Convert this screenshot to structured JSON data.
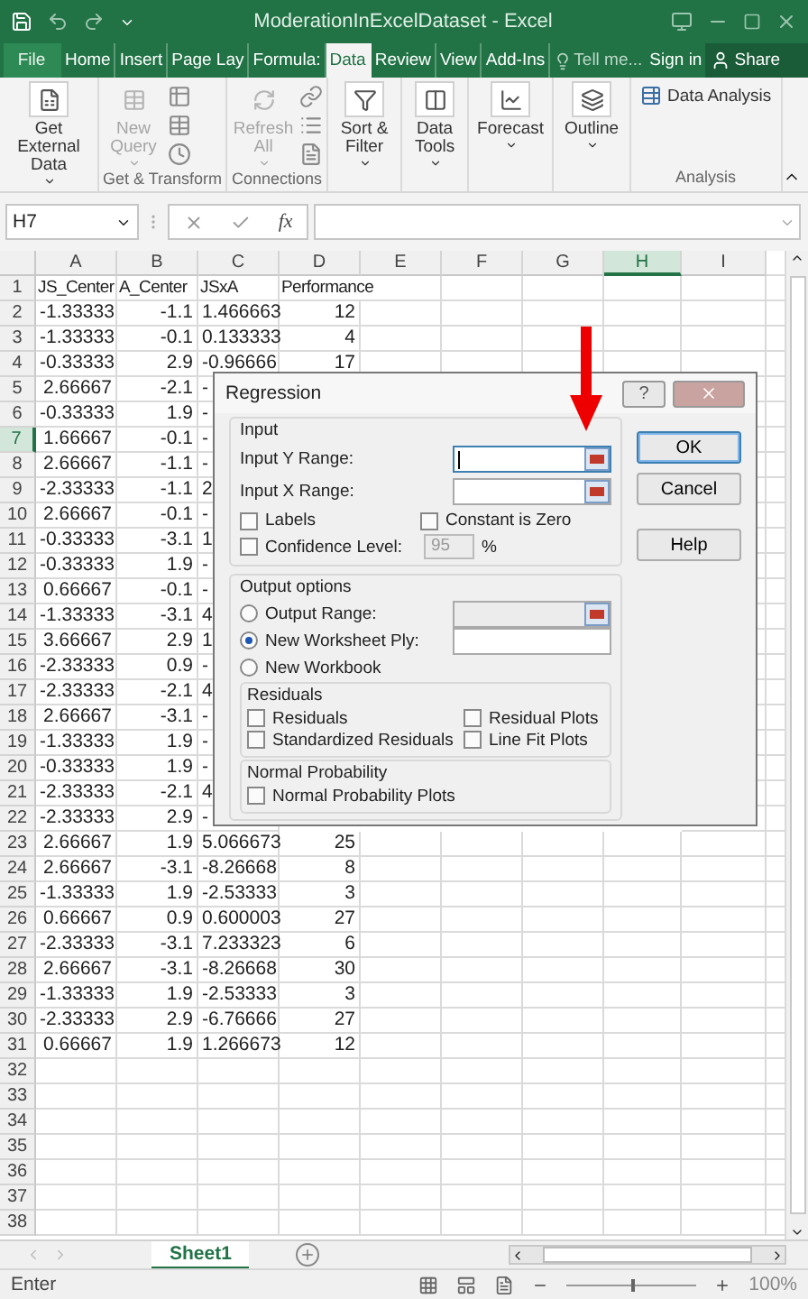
{
  "window": {
    "title": "ModerationInExcelDataset - Excel"
  },
  "ribbon_tabs": [
    {
      "label": "File",
      "selected": false
    },
    {
      "label": "Home",
      "selected": false
    },
    {
      "label": "Insert",
      "selected": false
    },
    {
      "label": "Page Lay",
      "selected": false
    },
    {
      "label": "Formula:",
      "selected": false
    },
    {
      "label": "Data",
      "selected": true
    },
    {
      "label": "Review",
      "selected": false
    },
    {
      "label": "View",
      "selected": false
    },
    {
      "label": "Add-Ins",
      "selected": false
    }
  ],
  "tell_me": "Tell me...",
  "sign_in": "Sign in",
  "share": "Share",
  "ribbon_groups": [
    {
      "buttons": [
        {
          "kind": "large",
          "label": "Get External Data",
          "disabled": false,
          "dropdown": true
        }
      ]
    },
    {
      "label": "Get & Transform",
      "buttons": [
        {
          "kind": "large",
          "label": "New Query",
          "disabled": true,
          "dropdown": true
        },
        {
          "kind": "small_stack",
          "disabled": false
        }
      ]
    },
    {
      "label": "Connections",
      "buttons": [
        {
          "kind": "large",
          "label": "Refresh All",
          "disabled": true,
          "dropdown": true
        },
        {
          "kind": "small_stack",
          "disabled": false
        }
      ]
    },
    {
      "buttons": [
        {
          "kind": "large",
          "label": "Sort & Filter",
          "disabled": false,
          "dropdown": true
        }
      ]
    },
    {
      "buttons": [
        {
          "kind": "large",
          "label": "Data Tools",
          "disabled": false,
          "dropdown": true
        }
      ]
    },
    {
      "buttons": [
        {
          "kind": "large",
          "label": "Forecast",
          "disabled": false,
          "dropdown": true
        }
      ]
    },
    {
      "buttons": [
        {
          "kind": "large",
          "label": "Outline",
          "disabled": false,
          "dropdown": true
        }
      ]
    },
    {
      "label": "Analysis",
      "buttons": [
        {
          "kind": "small",
          "label": "Data Analysis",
          "disabled": false
        }
      ]
    }
  ],
  "formula_bar": {
    "name_box": "H7",
    "function_symbol": "fx"
  },
  "columns": [
    {
      "label": "A",
      "selected": false
    },
    {
      "label": "B",
      "selected": false
    },
    {
      "label": "C",
      "selected": false
    },
    {
      "label": "D",
      "selected": false
    },
    {
      "label": "E",
      "selected": false
    },
    {
      "label": "F",
      "selected": false
    },
    {
      "label": "G",
      "selected": false
    },
    {
      "label": "H",
      "selected": true
    },
    {
      "label": "I",
      "selected": false
    }
  ],
  "rows": [
    {
      "number": "1",
      "selected": false,
      "kind": "header",
      "cells": [
        "JS_Center",
        "A_Center",
        "JSxA",
        "Performance"
      ]
    },
    {
      "number": "2",
      "selected": false,
      "cells": [
        "-1.33333",
        "-1.1",
        "1.466663",
        "12"
      ]
    },
    {
      "number": "3",
      "selected": false,
      "cells": [
        "-1.33333",
        "-0.1",
        "0.133333",
        "4"
      ]
    },
    {
      "number": "4",
      "selected": false,
      "cells": [
        "-0.33333",
        "2.9",
        "-0.96666",
        "17"
      ]
    },
    {
      "number": "5",
      "selected": false,
      "clipped": true,
      "cells": [
        "2.66667",
        "-2.1",
        "-"
      ]
    },
    {
      "number": "6",
      "selected": false,
      "clipped": true,
      "cells": [
        "-0.33333",
        "1.9",
        "-"
      ]
    },
    {
      "number": "7",
      "selected": true,
      "clipped": true,
      "cells": [
        "1.66667",
        "-0.1",
        "-"
      ]
    },
    {
      "number": "8",
      "selected": false,
      "clipped": true,
      "cells": [
        "2.66667",
        "-1.1",
        "-"
      ]
    },
    {
      "number": "9",
      "selected": false,
      "clipped": true,
      "cells": [
        "-2.33333",
        "-1.1",
        "2"
      ]
    },
    {
      "number": "10",
      "selected": false,
      "clipped": true,
      "cells": [
        "2.66667",
        "-0.1",
        "-"
      ]
    },
    {
      "number": "11",
      "selected": false,
      "clipped": true,
      "cells": [
        "-0.33333",
        "-3.1",
        "1"
      ]
    },
    {
      "number": "12",
      "selected": false,
      "clipped": true,
      "cells": [
        "-0.33333",
        "1.9",
        "-"
      ]
    },
    {
      "number": "13",
      "selected": false,
      "clipped": true,
      "cells": [
        "0.66667",
        "-0.1",
        "-"
      ]
    },
    {
      "number": "14",
      "selected": false,
      "clipped": true,
      "cells": [
        "-1.33333",
        "-3.1",
        "4"
      ]
    },
    {
      "number": "15",
      "selected": false,
      "clipped": true,
      "cells": [
        "3.66667",
        "2.9",
        "1"
      ]
    },
    {
      "number": "16",
      "selected": false,
      "clipped": true,
      "cells": [
        "-2.33333",
        "0.9",
        "-"
      ]
    },
    {
      "number": "17",
      "selected": false,
      "clipped": true,
      "cells": [
        "-2.33333",
        "-2.1",
        "4"
      ]
    },
    {
      "number": "18",
      "selected": false,
      "clipped": true,
      "cells": [
        "2.66667",
        "-3.1",
        "-"
      ]
    },
    {
      "number": "19",
      "selected": false,
      "clipped": true,
      "cells": [
        "-1.33333",
        "1.9",
        "-"
      ]
    },
    {
      "number": "20",
      "selected": false,
      "clipped": true,
      "cells": [
        "-0.33333",
        "1.9",
        "-"
      ]
    },
    {
      "number": "21",
      "selected": false,
      "clipped": true,
      "cells": [
        "-2.33333",
        "-2.1",
        "4"
      ]
    },
    {
      "number": "22",
      "selected": false,
      "clipped": true,
      "cells": [
        "-2.33333",
        "2.9",
        "-"
      ]
    },
    {
      "number": "23",
      "selected": false,
      "cells": [
        "2.66667",
        "1.9",
        "5.066673",
        "25"
      ]
    },
    {
      "number": "24",
      "selected": false,
      "cells": [
        "2.66667",
        "-3.1",
        "-8.26668",
        "8"
      ]
    },
    {
      "number": "25",
      "selected": false,
      "cells": [
        "-1.33333",
        "1.9",
        "-2.53333",
        "3"
      ]
    },
    {
      "number": "26",
      "selected": false,
      "cells": [
        "0.66667",
        "0.9",
        "0.600003",
        "27"
      ]
    },
    {
      "number": "27",
      "selected": false,
      "cells": [
        "-2.33333",
        "-3.1",
        "7.233323",
        "6"
      ]
    },
    {
      "number": "28",
      "selected": false,
      "cells": [
        "2.66667",
        "-3.1",
        "-8.26668",
        "30"
      ]
    },
    {
      "number": "29",
      "selected": false,
      "cells": [
        "-1.33333",
        "1.9",
        "-2.53333",
        "3"
      ]
    },
    {
      "number": "30",
      "selected": false,
      "cells": [
        "-2.33333",
        "2.9",
        "-6.76666",
        "27"
      ]
    },
    {
      "number": "31",
      "selected": false,
      "cells": [
        "0.66667",
        "1.9",
        "1.266673",
        "12"
      ]
    },
    {
      "number": "32",
      "selected": false
    },
    {
      "number": "33",
      "selected": false
    },
    {
      "number": "34",
      "selected": false
    },
    {
      "number": "35",
      "selected": false
    },
    {
      "number": "36",
      "selected": false
    },
    {
      "number": "37",
      "selected": false
    },
    {
      "number": "38",
      "selected": false
    }
  ],
  "dialog": {
    "title": "Regression",
    "help_glyph": "?",
    "input": {
      "label": "Input",
      "ranges": [
        {
          "label": "Input Y Range:",
          "focused": true
        },
        {
          "label": "Input X Range:",
          "focused": false
        }
      ],
      "labels": {
        "label": "Labels",
        "checked": false
      },
      "constant_zero": {
        "label": "Constant is Zero",
        "checked": false
      },
      "confidence": {
        "label": "Confidence Level:",
        "checked": false,
        "value": "95",
        "unit": "%"
      }
    },
    "output": {
      "label": "Output options",
      "choices": [
        {
          "label": "Output Range:",
          "selected": false,
          "kind": "range"
        },
        {
          "label": "New Worksheet Ply:",
          "selected": true,
          "kind": "text"
        },
        {
          "label": "New Workbook",
          "selected": false,
          "kind": "plain"
        }
      ],
      "residuals": {
        "label": "Residuals",
        "options": [
          {
            "label": "Residuals",
            "checked": false
          },
          {
            "label": "Residual Plots",
            "checked": false
          },
          {
            "label": "Standardized Residuals",
            "checked": false
          },
          {
            "label": "Line Fit Plots",
            "checked": false
          }
        ]
      },
      "normal_probability": {
        "label": "Normal Probability",
        "options": [
          {
            "label": "Normal Probability Plots",
            "checked": false
          }
        ]
      }
    },
    "buttons": [
      {
        "label": "OK",
        "default": true
      },
      {
        "label": "Cancel",
        "default": false
      },
      {
        "label": "Help",
        "default": false
      }
    ]
  },
  "sheet_tabs": [
    {
      "label": "Sheet1",
      "selected": true
    }
  ],
  "status_bar": {
    "mode": "Enter",
    "zoom": "100%",
    "zoom_slider": {
      "level": 0.5
    }
  }
}
